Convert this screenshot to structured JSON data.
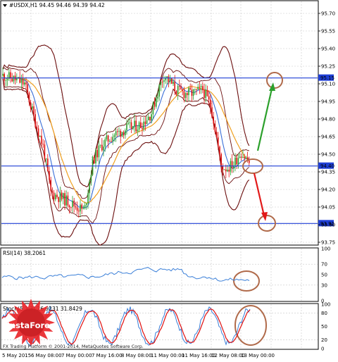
{
  "window": {
    "symbol_header": "#USDX,H1  94.45 94.46 94.39 94.42"
  },
  "price_axis": {
    "ticks": [
      "95.70",
      "95.55",
      "95.40",
      "95.25",
      "95.10",
      "94.95",
      "94.80",
      "94.65",
      "94.50",
      "94.35",
      "94.20",
      "94.05",
      "93.90",
      "93.75"
    ],
    "price_tags": [
      {
        "label": "95.15",
        "color": "#1f3fd6"
      },
      {
        "label": "94.40",
        "color": "#1f3fd6"
      },
      {
        "label": "93.91",
        "color": "#1f3fd6"
      }
    ]
  },
  "rsi_panel": {
    "header": "RSI(14) 38.2061",
    "ticks": [
      "100",
      "70",
      "50",
      "30",
      "0"
    ]
  },
  "stoch_panel": {
    "header": "Stoch(5,3,3) 26.9231 31.8429",
    "ticks": [
      "100",
      "80",
      "50",
      "20",
      "0"
    ]
  },
  "time_axis": {
    "labels": [
      "5 May 2015",
      "6 May 08:00",
      "7 May 00:00",
      "7 May 16:00",
      "8 May 08:00",
      "11 May 00:00",
      "11 May 16:00",
      "12 May 08:00",
      "13 May 00:00"
    ]
  },
  "watermark": {
    "brand": "InstaForex",
    "footer": "FX Trading Platform © 2001-2014, MetaQuotes Software Corp."
  },
  "colors": {
    "bull": "#2ea02e",
    "bear": "#e01010",
    "bands": "#6b0d0d",
    "ma_fast": "#3a6fd8",
    "ma_slow": "#f0a020",
    "level": "#1f3fd6",
    "annotation": "#b06a4a",
    "arrow_up": "#2ca02c",
    "arrow_down": "#e21a1a"
  }
}
